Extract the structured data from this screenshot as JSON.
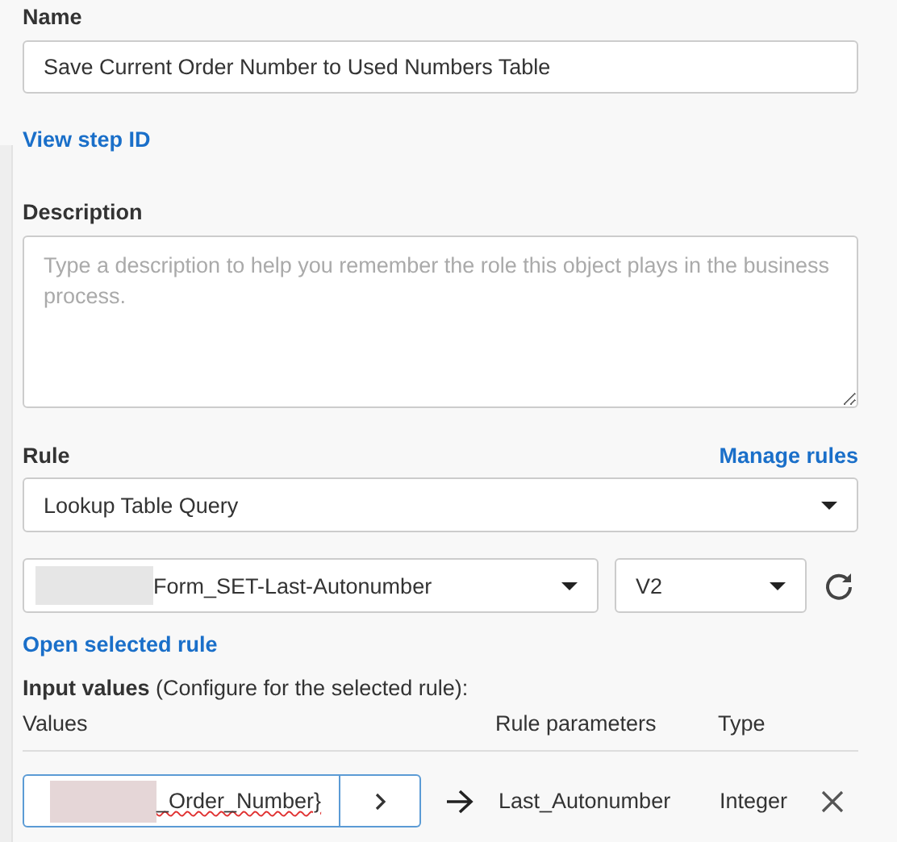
{
  "name_field": {
    "label": "Name",
    "value": "Save Current Order Number to Used Numbers Table"
  },
  "view_step_id_link": "View step ID",
  "description_field": {
    "label": "Description",
    "placeholder": "Type a description to help you remember the role this object plays in the business process."
  },
  "rule": {
    "label": "Rule",
    "manage_link": "Manage rules",
    "type_select": "Lookup Table Query",
    "rule_select": "Form_SET-Last-Autonumber",
    "version_select": "V2"
  },
  "open_rule_link": "Open selected rule",
  "input_values": {
    "heading": "Input values",
    "note": "(Configure for the selected rule):",
    "columns": [
      "Values",
      "Rule parameters",
      "Type"
    ],
    "rows": [
      {
        "value": "_Order_Number}",
        "parameter": "Last_Autonumber",
        "type": "Integer"
      }
    ]
  }
}
